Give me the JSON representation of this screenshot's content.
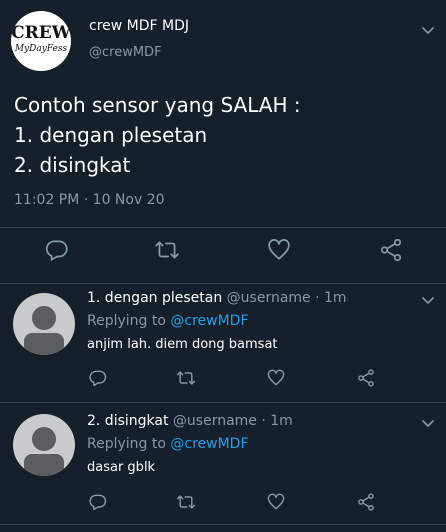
{
  "main_tweet": {
    "avatar": {
      "logo_line1": "CREW",
      "logo_line2": "MyDayFess"
    },
    "name": "crew MDF MDJ",
    "handle": "@crewMDF",
    "text": "Contoh sensor yang SALAH :\n1. dengan plesetan\n2. disingkat",
    "timestamp": "11:02 PM · 10 Nov 20"
  },
  "replies": [
    {
      "name": "1. dengan plesetan",
      "handle": "@username",
      "time": "· 1m",
      "replying_prefix": "Replying to",
      "replying_to": "@crewMDF",
      "text": "anjim lah. diem dong bamsat"
    },
    {
      "name": "2. disingkat",
      "handle": "@username",
      "time": "· 1m",
      "replying_prefix": "Replying to",
      "replying_to": "@crewMDF",
      "text": "dasar gblk"
    }
  ],
  "icons": [
    "chevron-down-icon",
    "reply-icon",
    "retweet-icon",
    "like-icon",
    "share-icon"
  ],
  "colors": {
    "background": "#15202b",
    "secondary_text": "#8899a6",
    "accent": "#1da1f2",
    "divider": "#38444d"
  }
}
